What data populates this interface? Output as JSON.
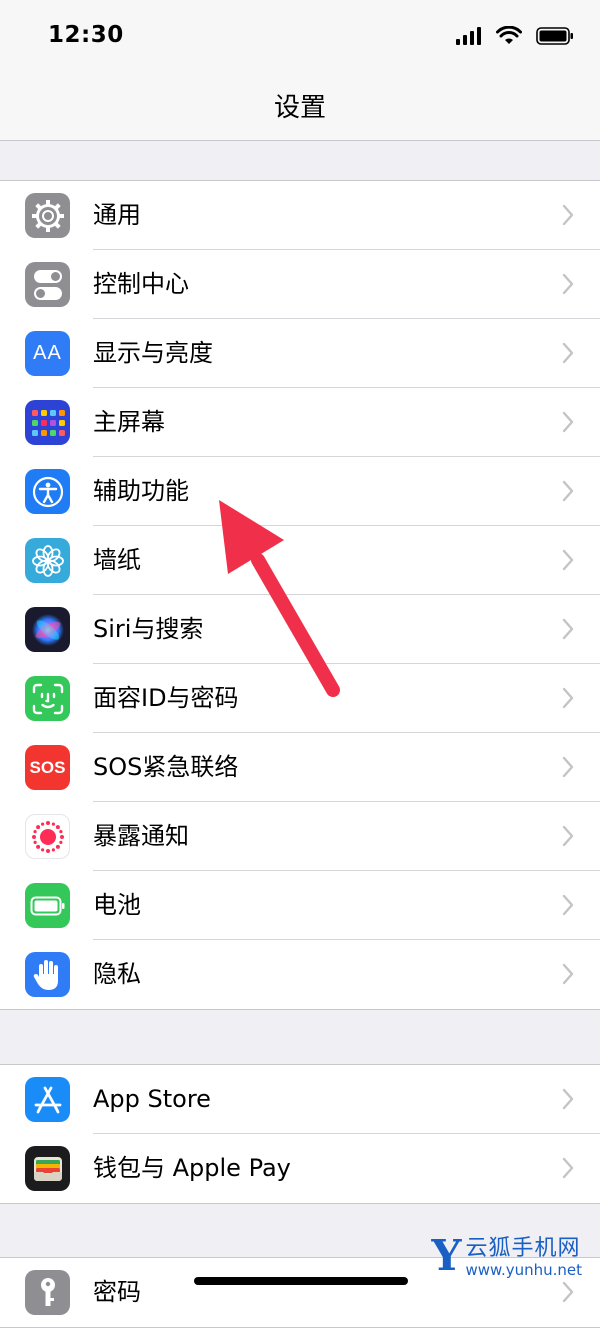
{
  "status_bar": {
    "time": "12:30"
  },
  "nav": {
    "title": "设置"
  },
  "groups": [
    {
      "items": [
        {
          "label": "通用",
          "icon": "gear-icon",
          "color": "#8e8e93"
        },
        {
          "label": "控制中心",
          "icon": "toggles-icon",
          "color": "#8e8e93"
        },
        {
          "label": "显示与亮度",
          "icon": "text-size-icon",
          "icon_text": "AA",
          "color": "#2f7cf6"
        },
        {
          "label": "主屏幕",
          "icon": "app-grid-icon",
          "color": "#2c43d6"
        },
        {
          "label": "辅助功能",
          "icon": "accessibility-icon",
          "color": "#1f7cf5"
        },
        {
          "label": "墙纸",
          "icon": "flower-icon",
          "color": "#37aadc"
        },
        {
          "label": "Siri与搜索",
          "icon": "siri-icon",
          "color": "#1a1a2e"
        },
        {
          "label": "面容ID与密码",
          "icon": "face-id-icon",
          "color": "#34c759"
        },
        {
          "label": "SOS紧急联络",
          "icon": "sos-icon",
          "icon_text": "SOS",
          "color": "#f2362f"
        },
        {
          "label": "暴露通知",
          "icon": "exposure-icon",
          "color": "#ffffff"
        },
        {
          "label": "电池",
          "icon": "battery-icon",
          "color": "#34c759"
        },
        {
          "label": "隐私",
          "icon": "hand-icon",
          "color": "#2f7cf6"
        }
      ]
    },
    {
      "items": [
        {
          "label": "App Store",
          "icon": "app-store-icon",
          "color": "#1a8cf8"
        },
        {
          "label": "钱包与 Apple Pay",
          "icon": "wallet-icon",
          "color": "#1c1c1e"
        }
      ]
    },
    {
      "items": [
        {
          "label": "密码",
          "icon": "key-icon",
          "color": "#8e8e93"
        }
      ]
    }
  ],
  "watermark": {
    "title": "云狐手机网",
    "url": "www.yunhu.net",
    "letter": "Y"
  },
  "annotation": {
    "arrow_color": "#f0304a"
  }
}
